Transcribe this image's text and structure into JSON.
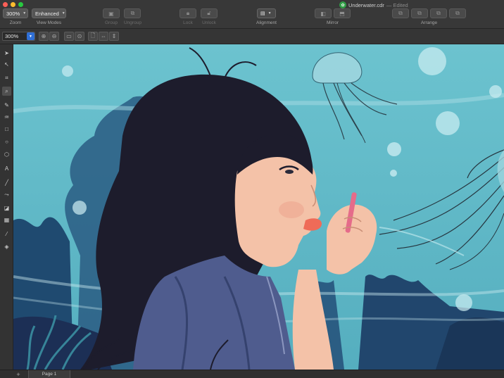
{
  "window": {
    "title": "Underwater.cdr",
    "status": "— Edited"
  },
  "toolbar": {
    "zoom": {
      "value": "300%",
      "label": "Zoom"
    },
    "view_modes": {
      "value": "Enhanced",
      "label": "View Modes"
    },
    "group": {
      "label": "Group"
    },
    "ungroup": {
      "label": "Ungroup"
    },
    "lock": {
      "label": "Lock"
    },
    "unlock": {
      "label": "Unlock"
    },
    "alignment": {
      "label": "Alignment"
    },
    "mirror": {
      "label": "Mirror"
    },
    "arrange": {
      "label": "Arrange"
    }
  },
  "property_bar": {
    "zoom_value": "300%"
  },
  "toolbox": {
    "tools": [
      "pick-tool",
      "shape-tool",
      "crop-tool",
      "zoom-tool",
      "freehand-tool",
      "artistic-media-tool",
      "rectangle-tool",
      "ellipse-tool",
      "polygon-tool",
      "text-tool",
      "parallel-dimension-tool",
      "connector-tool",
      "drop-shadow-tool",
      "transparency-tool",
      "eyedropper-tool",
      "interactive-fill-tool"
    ]
  },
  "pages": {
    "add_label": "+",
    "tabs": [
      "Page 1"
    ]
  },
  "colors": {
    "water": "#5fb8c6",
    "hair": "#1d1c2c",
    "skin": "#f4c2a8",
    "lips": "#ef6b58",
    "shirt": "#4f5c8e",
    "seaweed": "#1c3f66"
  }
}
